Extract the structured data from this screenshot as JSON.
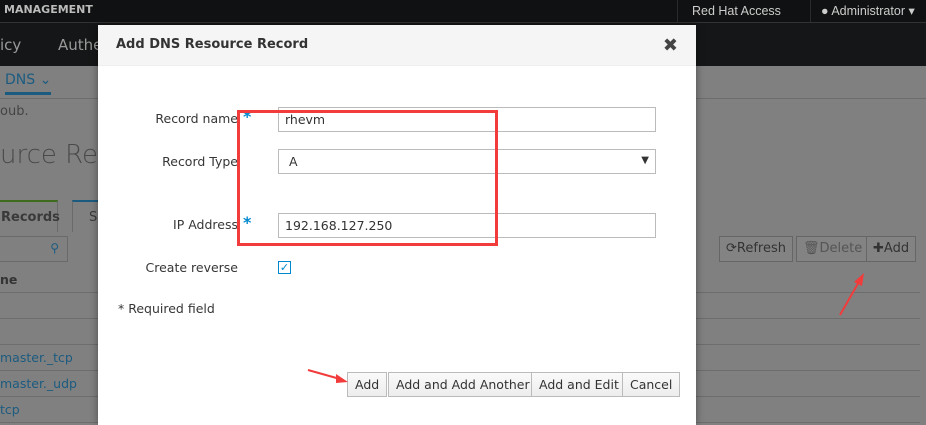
{
  "topbar": {
    "brand": "MANAGEMENT",
    "red_hat_access": "Red Hat Access",
    "user": "Administrator"
  },
  "nav": {
    "items": [
      "icy",
      "Authe"
    ]
  },
  "subnav": {
    "dns": "DNS"
  },
  "background": {
    "text_fragment": "oub.",
    "title_fragment": "urce Reco",
    "tabs": [
      "Records",
      "Se"
    ],
    "table_header": "ne",
    "rows": [
      "",
      "",
      "master._tcp",
      "master._udp",
      "tcp"
    ],
    "buttons": {
      "refresh": "Refresh",
      "delete": "Delete",
      "add": "Add"
    }
  },
  "modal": {
    "title": "Add DNS Resource Record",
    "record_name_label": "Record name",
    "record_name_value": "rhevm",
    "record_type_label": "Record Type",
    "record_type_value": "A",
    "ip_label": "IP Address",
    "ip_value": "192.168.127.250",
    "create_reverse_label": "Create reverse",
    "create_reverse_checked": true,
    "required_asterisk": "*",
    "required_note": "* Required field",
    "buttons": {
      "add": "Add",
      "add_another": "Add and Add Another",
      "add_edit": "Add and Edit",
      "cancel": "Cancel"
    }
  },
  "colors": {
    "accent": "#0088ce",
    "annotation": "#f23b3b"
  }
}
